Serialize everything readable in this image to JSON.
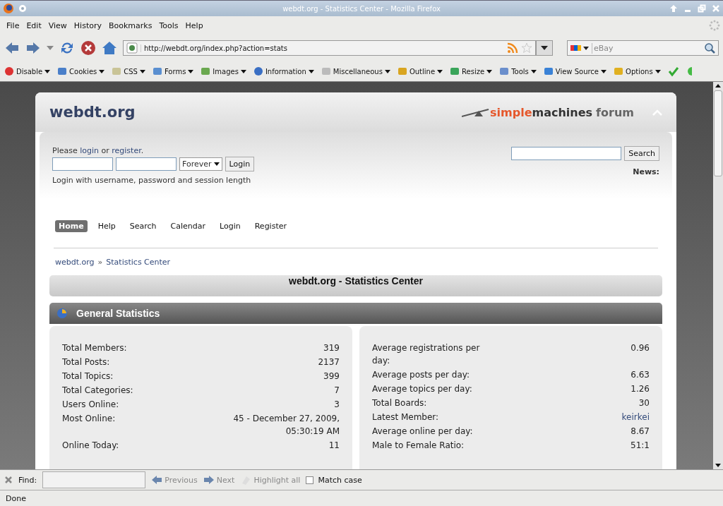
{
  "window": {
    "title": "webdt.org - Statistics Center - Mozilla Firefox"
  },
  "menu": [
    "File",
    "Edit",
    "View",
    "History",
    "Bookmarks",
    "Tools",
    "Help"
  ],
  "address": {
    "value": "http://webdt.org/index.php?action=stats"
  },
  "search_engine": {
    "placeholder": "eBay"
  },
  "devtools": [
    "Disable",
    "Cookies",
    "CSS",
    "Forms",
    "Images",
    "Information",
    "Miscellaneous",
    "Outline",
    "Resize",
    "Tools",
    "View Source",
    "Options"
  ],
  "site": {
    "title": "webdt.org",
    "logo": [
      "simple",
      "machines",
      "forum"
    ]
  },
  "login": {
    "prompt_before": "Please ",
    "login_link": "login",
    "prompt_mid": " or ",
    "register_link": "register",
    "prompt_after": ".",
    "session": "Forever",
    "button": "Login",
    "hint": "Login with username, password and session length"
  },
  "search": {
    "button": "Search"
  },
  "news": "News:",
  "nav": [
    {
      "label": "Home",
      "selected": true
    },
    {
      "label": "Help",
      "selected": false
    },
    {
      "label": "Search",
      "selected": false
    },
    {
      "label": "Calendar",
      "selected": false
    },
    {
      "label": "Login",
      "selected": false
    },
    {
      "label": "Register",
      "selected": false
    }
  ],
  "breadcrumb": [
    "webdt.org",
    "»",
    "Statistics Center"
  ],
  "page_title": "webdt.org - Statistics Center",
  "section_title": "General Statistics",
  "stats_left": [
    {
      "label": "Total Members:",
      "value": "319"
    },
    {
      "label": "Total Posts:",
      "value": "2137"
    },
    {
      "label": "Total Topics:",
      "value": "399"
    },
    {
      "label": "Total Categories:",
      "value": "7"
    },
    {
      "label": "Users Online:",
      "value": "3"
    },
    {
      "label": "Most Online:",
      "value": "45 - December 27, 2009, 05:30:19 AM"
    },
    {
      "label": "Online Today:",
      "value": "11"
    }
  ],
  "stats_right": [
    {
      "label": "Average registrations per day:",
      "value": "0.96",
      "kind": "text"
    },
    {
      "label": "Average posts per day:",
      "value": "6.63",
      "kind": "text"
    },
    {
      "label": "Average topics per day:",
      "value": "1.26",
      "kind": "text"
    },
    {
      "label": "Total Boards:",
      "value": "30",
      "kind": "text"
    },
    {
      "label": "Latest Member:",
      "value": "keirkei",
      "kind": "link"
    },
    {
      "label": "Average online per day:",
      "value": "8.67",
      "kind": "text"
    },
    {
      "label": "Male to Female Ratio:",
      "value": "51:1",
      "kind": "text"
    }
  ],
  "find_bar": {
    "label": "Find:",
    "buttons": [
      {
        "label": "Previous",
        "disabled": true
      },
      {
        "label": "Next",
        "disabled": true
      },
      {
        "label": "Highlight all",
        "disabled": true
      }
    ],
    "match_case": {
      "label": "Match case",
      "checked": false
    }
  },
  "status_bar": "Done"
}
